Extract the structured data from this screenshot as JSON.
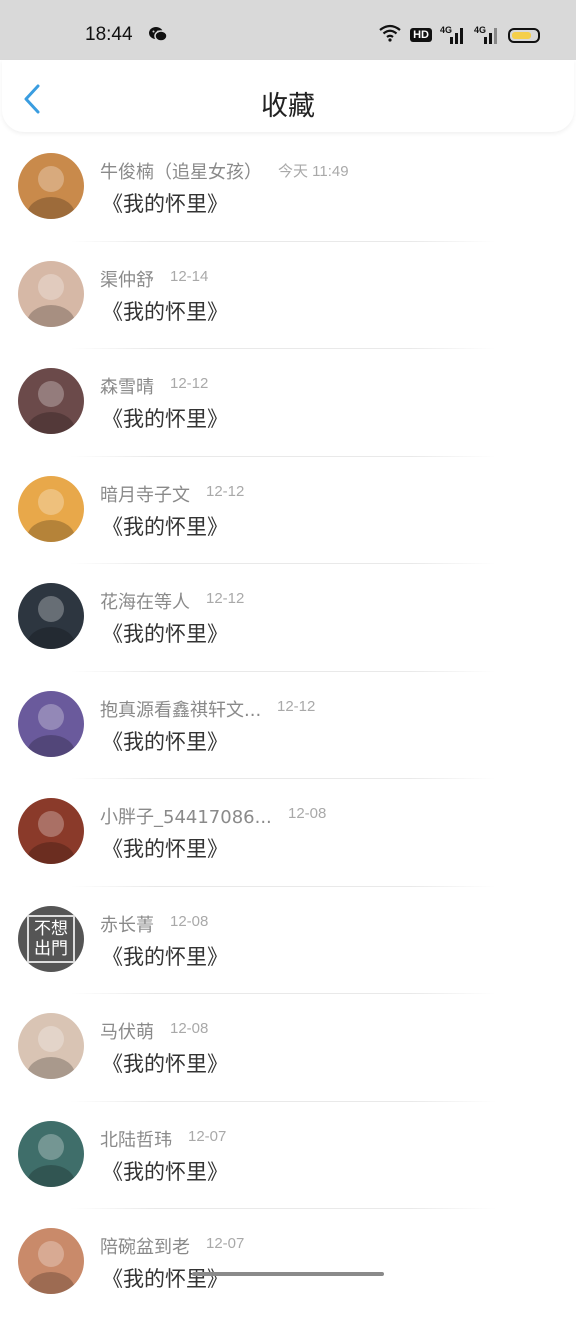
{
  "status_bar": {
    "time": "18:44",
    "hd_label": "HD",
    "network_label_1": "4G",
    "network_label_2": "4G"
  },
  "header": {
    "title": "收藏"
  },
  "items": [
    {
      "name": "牛俊楠（追星女孩）",
      "time": "今天 11:49",
      "content": "《我的怀里》",
      "avatar_color": "#c98a4b"
    },
    {
      "name": "渠仲舒",
      "time": "12-14",
      "content": "《我的怀里》",
      "avatar_color": "#d6b8a6"
    },
    {
      "name": "森雪晴",
      "time": "12-12",
      "content": "《我的怀里》",
      "avatar_color": "#6b4a4a"
    },
    {
      "name": "暗月寺子文",
      "time": "12-12",
      "content": "《我的怀里》",
      "avatar_color": "#e8a84a"
    },
    {
      "name": "花海在等人",
      "time": "12-12",
      "content": "《我的怀里》",
      "avatar_color": "#2d3640"
    },
    {
      "name": "抱真源看鑫祺轩文...",
      "time": "12-12",
      "content": "《我的怀里》",
      "avatar_color": "#6a5a9c"
    },
    {
      "name": "小胖子_54417086...",
      "time": "12-08",
      "content": "《我的怀里》",
      "avatar_color": "#8a3a2a"
    },
    {
      "name": "赤长菁",
      "time": "12-08",
      "content": "《我的怀里》",
      "avatar_color": "#555555",
      "avatar_text": "不想出門"
    },
    {
      "name": "马伏萌",
      "time": "12-08",
      "content": "《我的怀里》",
      "avatar_color": "#d9c4b4"
    },
    {
      "name": "北陆哲玮",
      "time": "12-07",
      "content": "《我的怀里》",
      "avatar_color": "#3f6e6a"
    },
    {
      "name": "陪碗盆到老",
      "time": "12-07",
      "content": "《我的怀里》",
      "avatar_color": "#c98a6a"
    }
  ]
}
